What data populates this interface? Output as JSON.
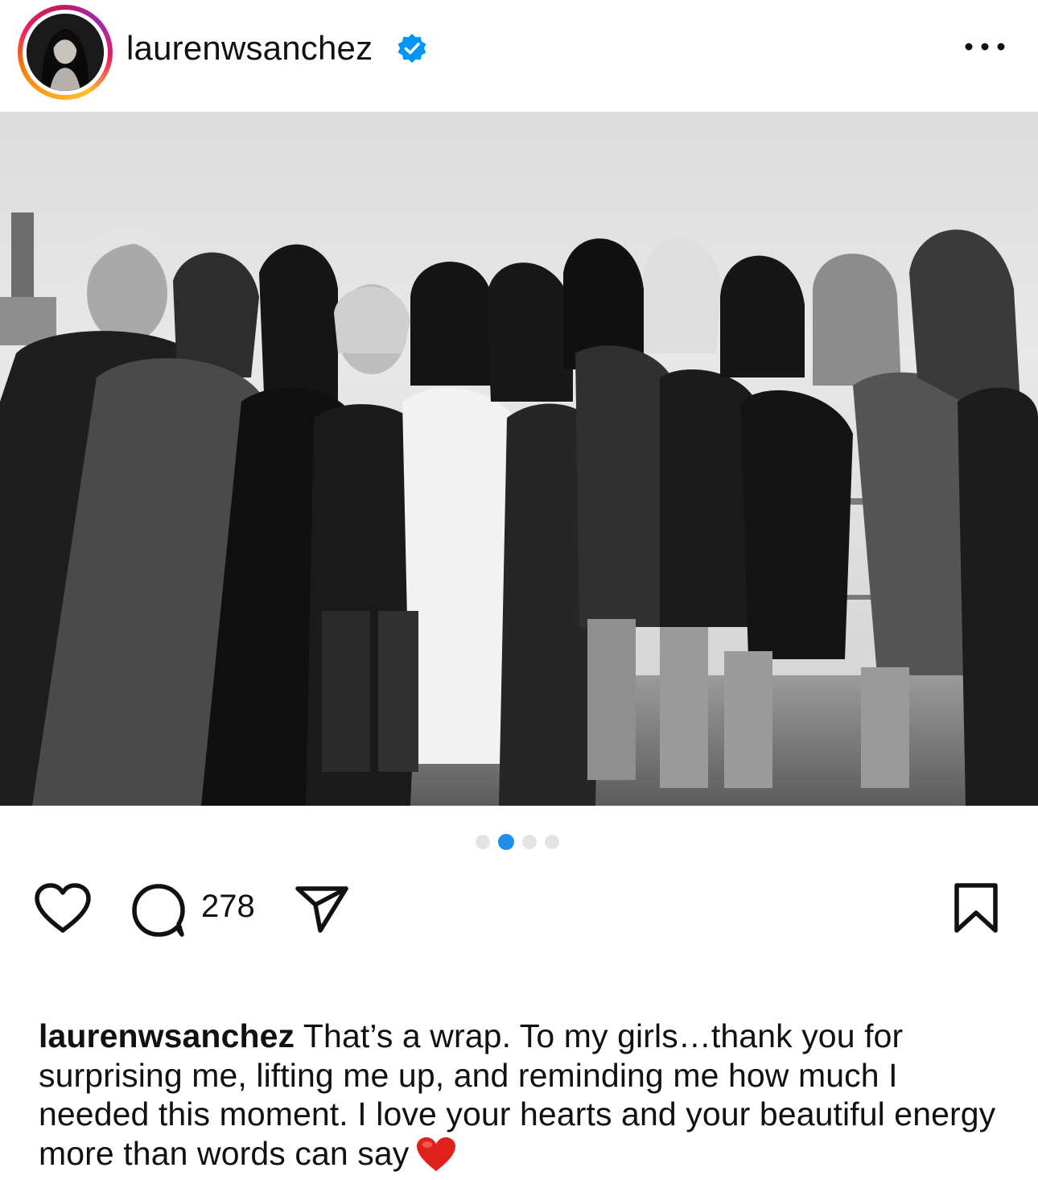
{
  "post": {
    "username": "laurenwsanchez",
    "verified": true,
    "more_icon": "more-horizontal-icon",
    "carousel": {
      "total": 4,
      "active_index": 1
    },
    "actions": {
      "like_icon": "heart-outline-icon",
      "comment_icon": "comment-bubble-icon",
      "comment_count": "278",
      "share_icon": "paper-plane-icon",
      "save_icon": "bookmark-outline-icon"
    },
    "caption": {
      "username": "laurenwsanchez",
      "text": "That’s a wrap. To my girls…thank you for surprising me, lifting me up, and reminding me how much I needed this moment. I love your hearts and your beautiful energy more than words can say",
      "emoji": "red-heart-emoji"
    }
  },
  "colors": {
    "accent_blue": "#1d8ef0",
    "verified_blue": "#0095f6",
    "text": "#111111",
    "heart_red": "#e0201b"
  }
}
